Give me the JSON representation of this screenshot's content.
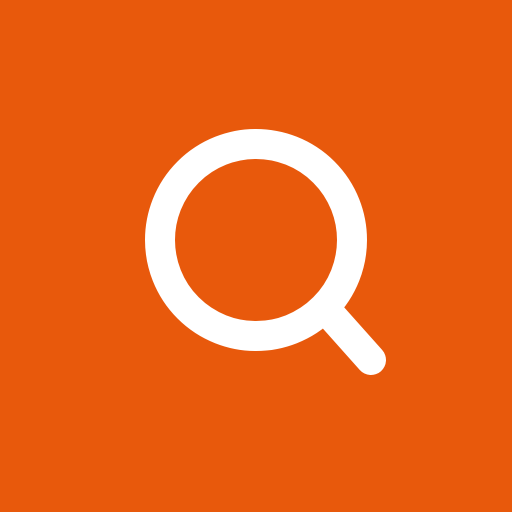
{
  "icon": {
    "name": "search-icon"
  },
  "colors": {
    "background": "#E8590C",
    "icon": "#FFFFFF"
  }
}
